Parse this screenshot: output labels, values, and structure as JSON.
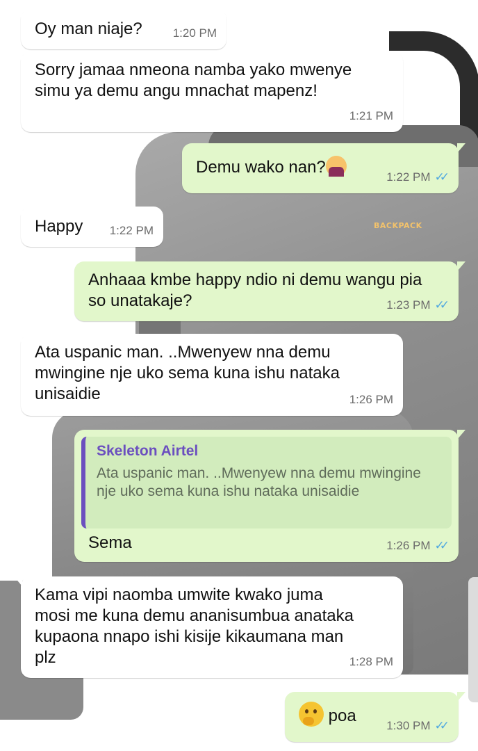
{
  "wallpaper": {
    "logo_text": "BACKPACK"
  },
  "messages": [
    {
      "dir": "in",
      "text": "Oy man niaje?",
      "time": "1:20 PM"
    },
    {
      "dir": "in",
      "text": "Sorry jamaa nmeona namba  yako mwenye simu ya demu angu mnachat mapenz!",
      "time": "1:21 PM"
    },
    {
      "dir": "out",
      "text": "Demu wako nan?",
      "emoji": "person-shrugging-emoji",
      "time": "1:22 PM",
      "status": "read"
    },
    {
      "dir": "in",
      "text": "Happy",
      "time": "1:22 PM"
    },
    {
      "dir": "out",
      "text": "Anhaaa kmbe happy ndio ni demu wangu pia so unatakaje?",
      "time": "1:23 PM",
      "status": "read"
    },
    {
      "dir": "in",
      "text": "Ata uspanic man. ..Mwenyew nna demu mwingine nje uko sema kuna ishu nataka unisaidie",
      "time": "1:26 PM"
    },
    {
      "dir": "out",
      "quoted_author": "Skeleton Airtel",
      "quoted_text": "Ata uspanic man. ..Mwenyew nna demu mwingine nje uko sema kuna ishu nataka unisaidie",
      "text": "Sema",
      "time": "1:26 PM",
      "status": "read"
    },
    {
      "dir": "in",
      "text": "Kama vipi naomba umwite kwako juma mosi me kuna demu ananisumbua anataka kupaona nnapo ishi kisije kikaumana man plz",
      "time": "1:28 PM"
    },
    {
      "dir": "out",
      "emoji": "thinking-face-emoji",
      "text": "poa",
      "time": "1:30 PM",
      "status": "read"
    }
  ],
  "ticks_glyph": "✓✓",
  "colors": {
    "incoming": "#ffffff",
    "outgoing": "#e2f7cb",
    "read_ticks": "#4fa8e0",
    "quote_accent": "#6b4fbf"
  }
}
